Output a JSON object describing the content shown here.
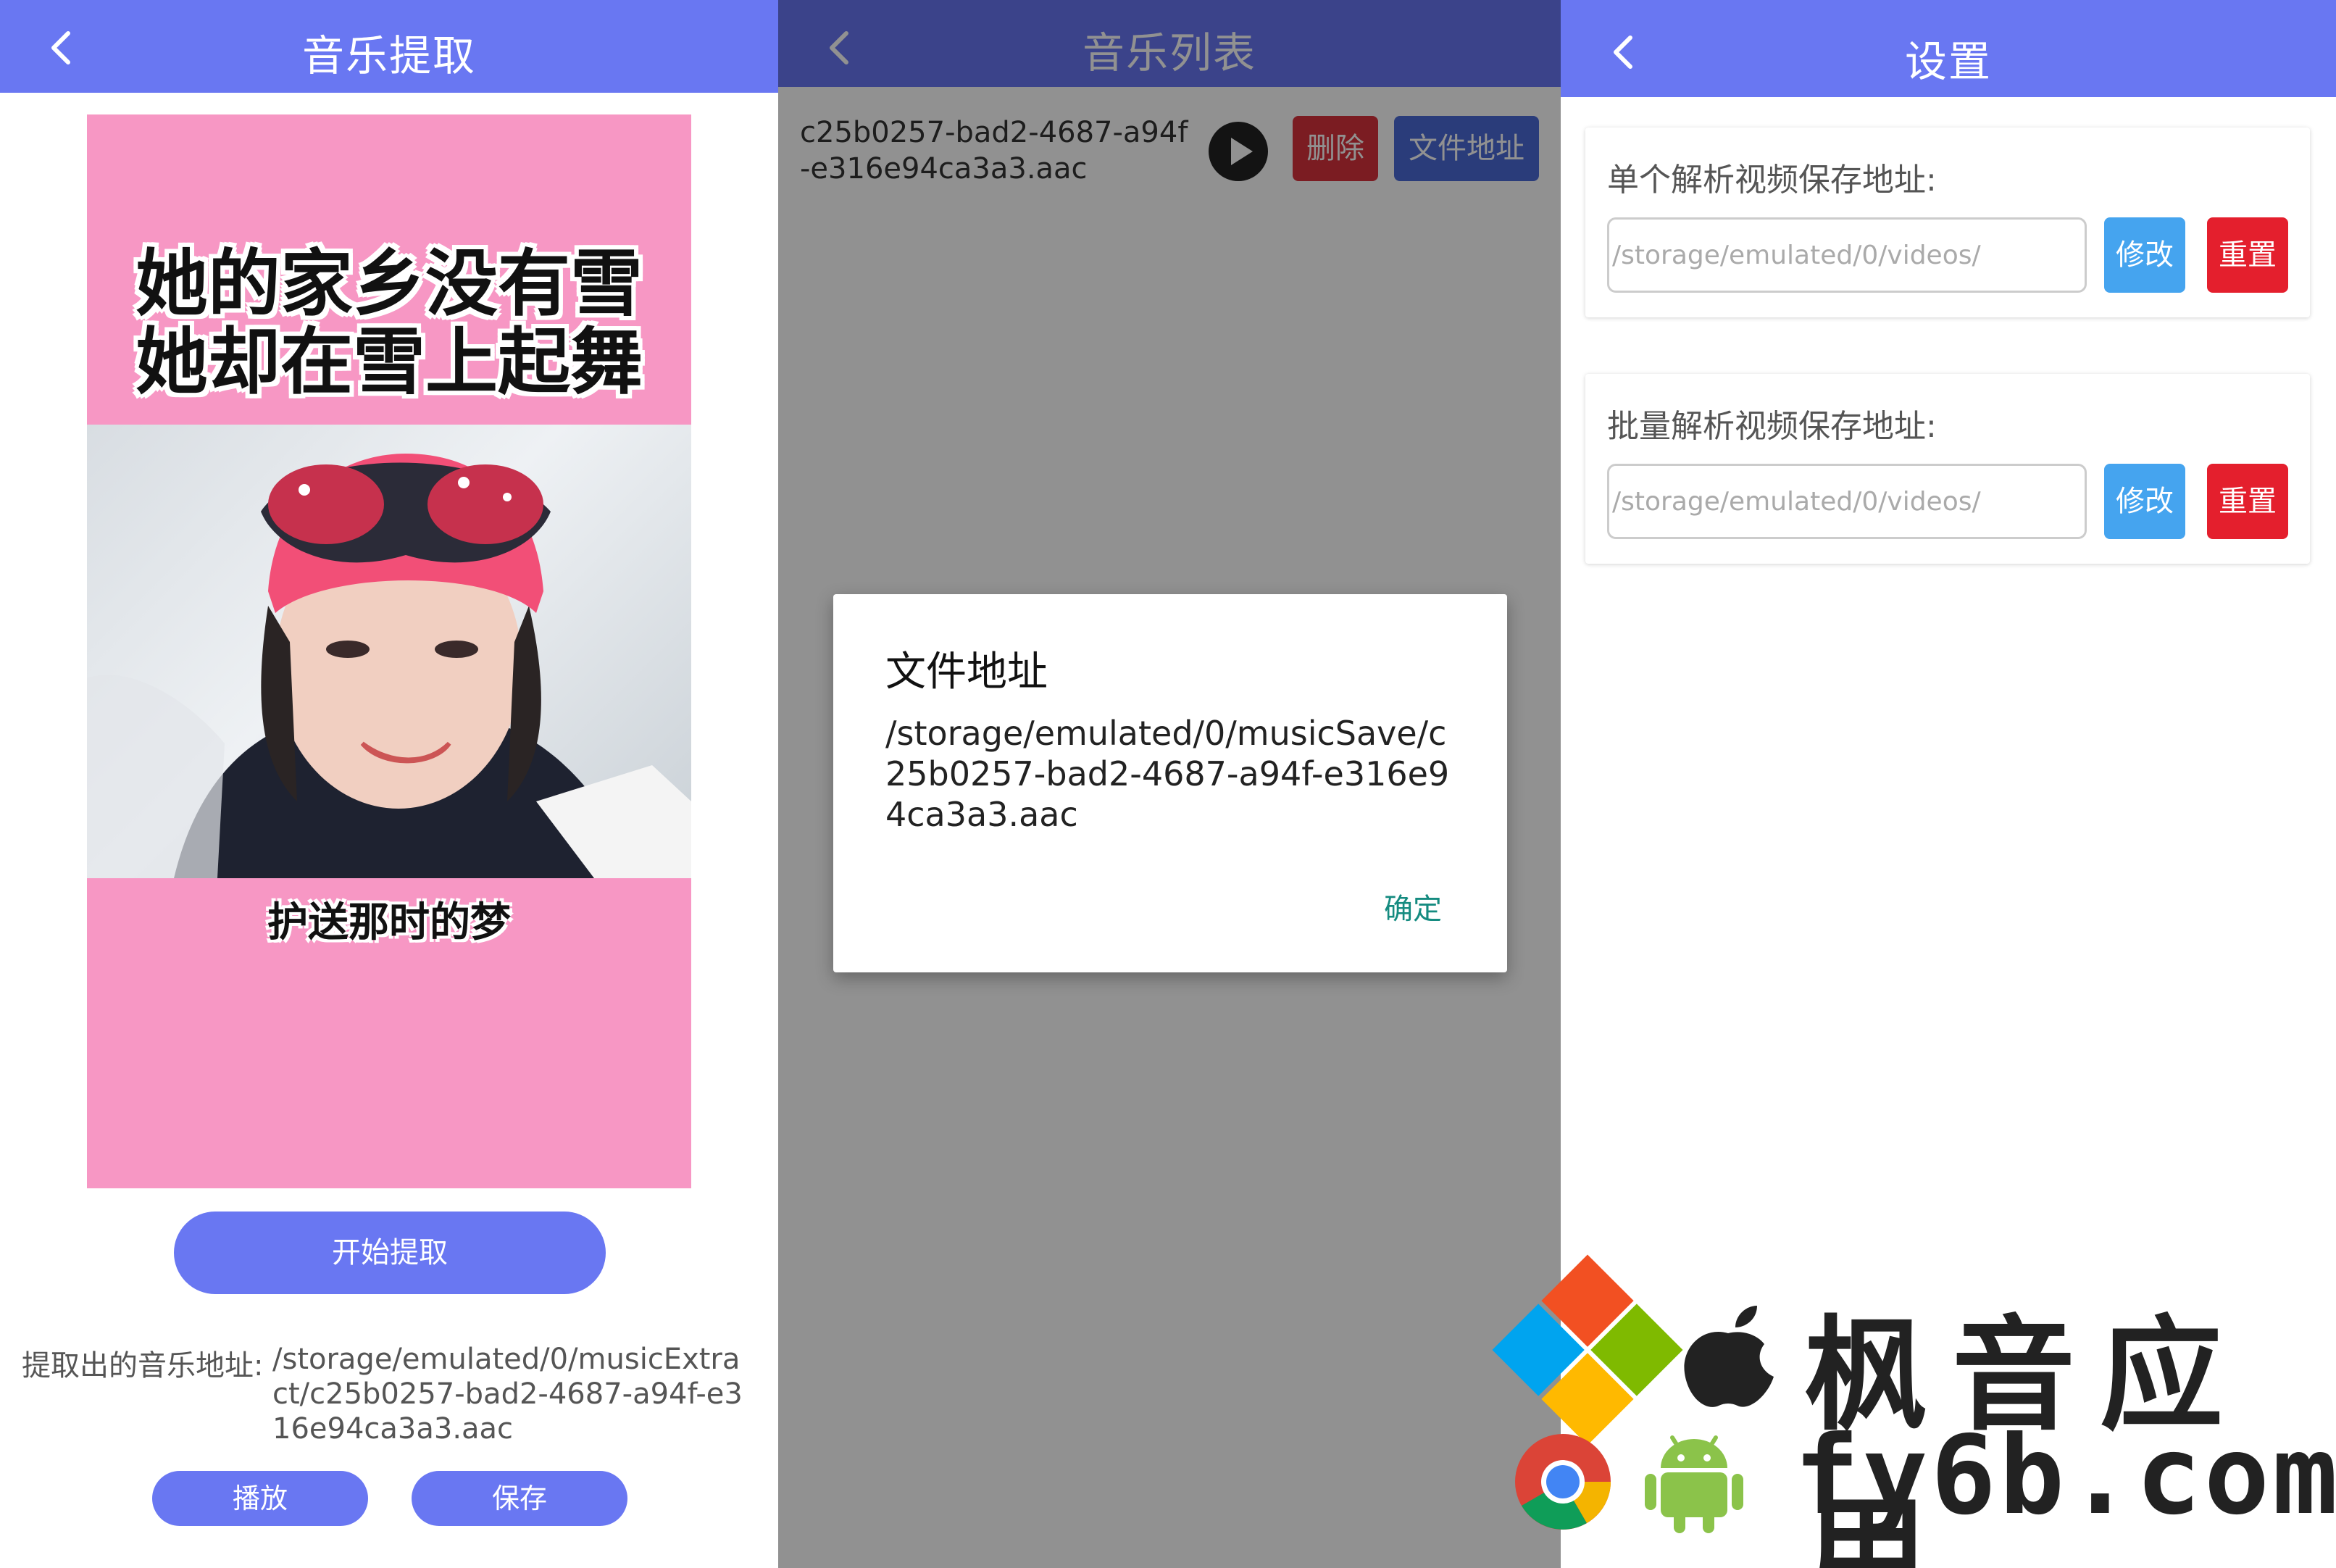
{
  "panel1": {
    "title": "音乐提取",
    "video": {
      "caption_top_line1": "她的家乡没有雪",
      "caption_top_line2": "她却在雪上起舞",
      "caption_bottom": "护送那时的梦"
    },
    "start_button": "开始提取",
    "extract_label": "提取出的音乐地址:",
    "extract_path": "/storage/emulated/0/musicExtract/c25b0257-bad2-4687-a94f-e316e94ca3a3.aac",
    "play_button": "播放",
    "save_button": "保存"
  },
  "panel2": {
    "title": "音乐列表",
    "file_name": "c25b0257-bad2-4687-a94f-e316e94ca3a3.aac",
    "delete_button": "删除",
    "file_address_button": "文件地址",
    "dialog": {
      "title": "文件地址",
      "body": "/storage/emulated/0/musicSave/c25b0257-bad2-4687-a94f-e316e94ca3a3.aac",
      "ok": "确定"
    }
  },
  "panel3": {
    "title": "设置",
    "single": {
      "label": "单个解析视频保存地址:",
      "placeholder": "/storage/emulated/0/videos/",
      "edit": "修改",
      "reset": "重置"
    },
    "batch": {
      "label": "批量解析视频保存地址:",
      "placeholder": "/storage/emulated/0/videos/",
      "edit": "修改",
      "reset": "重置"
    }
  },
  "watermark": {
    "brand": "枫音应用",
    "domain": "fy6b.com"
  },
  "colors": {
    "appbar": "#6977f2",
    "delete": "#d9323c",
    "file_address": "#4a6ad6",
    "edit": "#45a4ef",
    "reset": "#e41f2d",
    "dialog_ok": "#158b80"
  }
}
